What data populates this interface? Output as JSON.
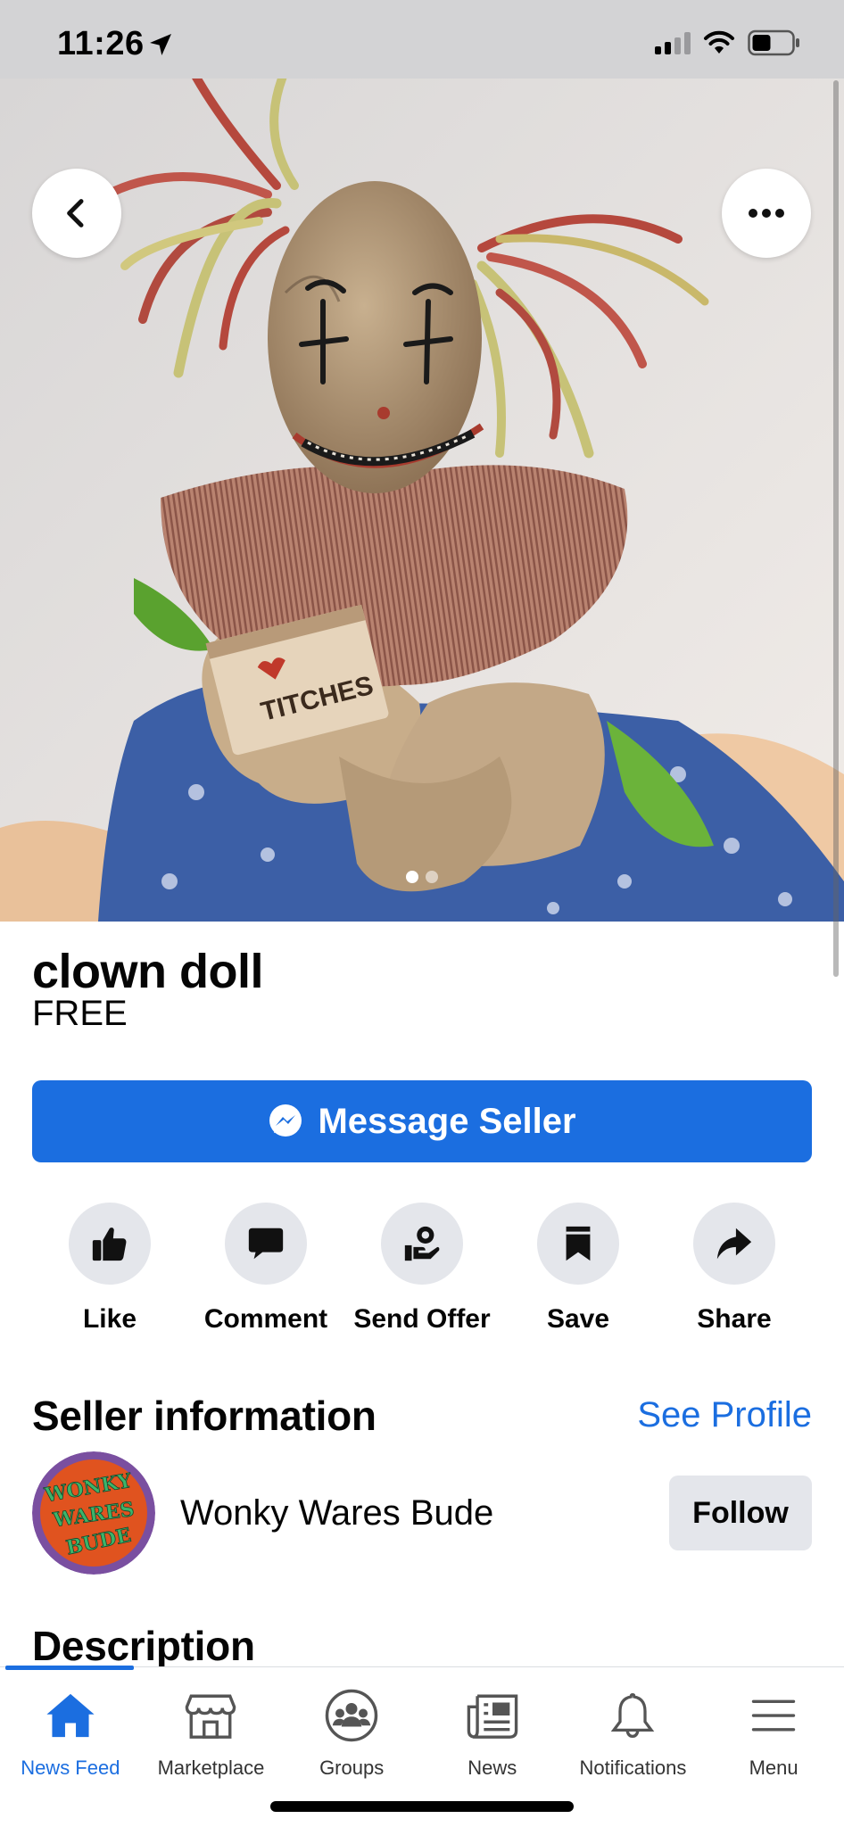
{
  "status_bar": {
    "time": "11:26",
    "location_icon": "location-arrow-icon",
    "signal_icon": "cellular-signal-icon",
    "wifi_icon": "wifi-icon",
    "battery_icon": "battery-icon"
  },
  "hero": {
    "photo_description_icon": "product-photo",
    "back_icon": "chevron-left-icon",
    "more_icon": "more-horizontal-icon",
    "image_count": 2,
    "current_image": 1
  },
  "listing": {
    "title": "clown doll",
    "price": "FREE",
    "message_button": "Message Seller"
  },
  "actions": [
    {
      "label": "Like",
      "icon": "thumbs-up-icon"
    },
    {
      "label": "Comment",
      "icon": "comment-icon"
    },
    {
      "label": "Send Offer",
      "icon": "send-offer-icon"
    },
    {
      "label": "Save",
      "icon": "bookmark-icon"
    },
    {
      "label": "Share",
      "icon": "share-arrow-icon"
    }
  ],
  "seller": {
    "section_title": "Seller information",
    "see_profile": "See Profile",
    "name": "Wonky Wares Bude",
    "follow": "Follow",
    "avatar_logo_text": "WONKY WARES BUDE"
  },
  "description": {
    "section_title": "Description"
  },
  "bottom_nav": {
    "items": [
      {
        "label": "News Feed",
        "icon": "home-icon",
        "active": true
      },
      {
        "label": "Marketplace",
        "icon": "marketplace-icon",
        "active": false
      },
      {
        "label": "Groups",
        "icon": "groups-icon",
        "active": false
      },
      {
        "label": "News",
        "icon": "news-icon",
        "active": false
      },
      {
        "label": "Notifications",
        "icon": "bell-icon",
        "active": false
      },
      {
        "label": "Menu",
        "icon": "menu-icon",
        "active": false
      }
    ]
  },
  "colors": {
    "accent": "#1b6ee0",
    "button_gray": "#e4e6eb",
    "text": "#050505"
  }
}
